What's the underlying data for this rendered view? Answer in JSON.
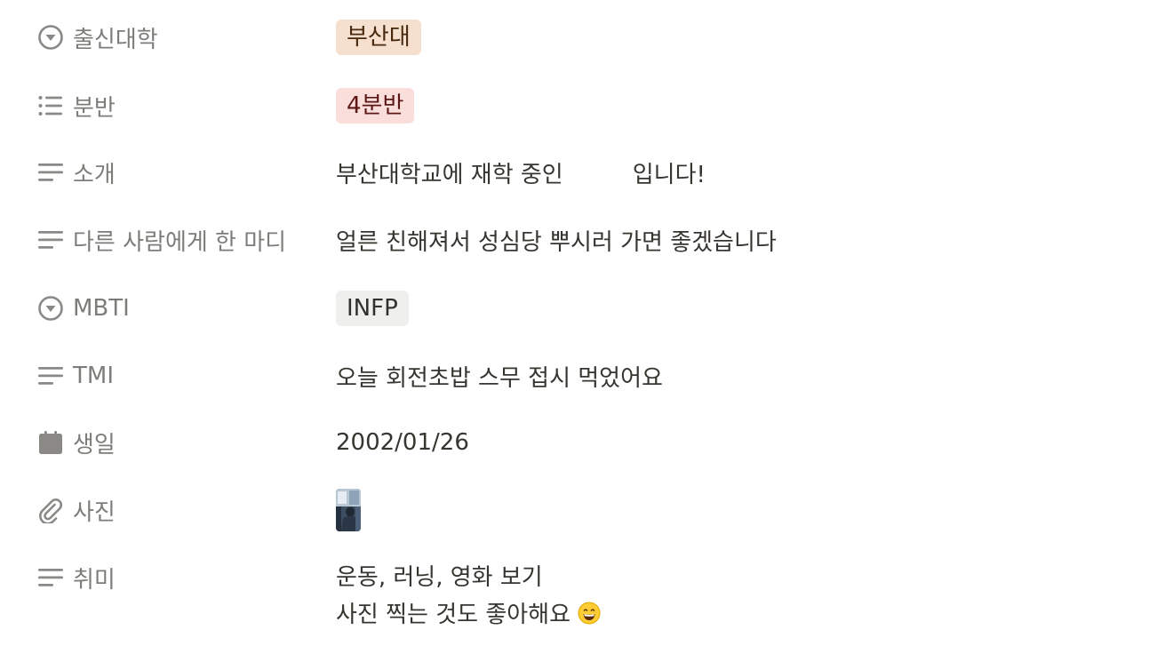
{
  "properties": [
    {
      "icon": "select-circle-icon",
      "name": "출신대학",
      "type": "tag",
      "value": "부산대",
      "tag_color": "orange"
    },
    {
      "icon": "multi-select-list-icon",
      "name": "분반",
      "type": "tag",
      "value": "4분반",
      "tag_color": "red"
    },
    {
      "icon": "text-lines-icon",
      "name": "소개",
      "type": "text",
      "value_part1": "부산대학교에 재학 중인",
      "value_part2": "입니다!"
    },
    {
      "icon": "text-lines-icon",
      "name": "다른 사람에게 한 마디",
      "type": "text",
      "value": "얼른 친해져서 성심당 뿌시러 가면 좋겠습니다"
    },
    {
      "icon": "select-circle-icon",
      "name": "MBTI",
      "type": "tag",
      "value": "INFP",
      "tag_color": "gray"
    },
    {
      "icon": "text-lines-icon",
      "name": "TMI",
      "type": "text",
      "value": "오늘 회전초밥 스무 접시 먹었어요"
    },
    {
      "icon": "calendar-icon",
      "name": "생일",
      "type": "date",
      "value": "2002/01/26"
    },
    {
      "icon": "paperclip-icon",
      "name": "사진",
      "type": "file",
      "value": "photo-thumbnail"
    },
    {
      "icon": "text-lines-icon",
      "name": "취미",
      "type": "text",
      "value_line1": "운동, 러닝, 영화 보기",
      "value_line2": "사진 찍는 것도 좋아해요",
      "value_line2_emoji": "grinning-face-emoji"
    }
  ],
  "colors": {
    "tag_orange_bg": "#f5e0d0",
    "tag_red_bg": "#f9dedc",
    "tag_gray_bg": "#efefed",
    "text": "#37352f",
    "label": "#7d7c78"
  }
}
